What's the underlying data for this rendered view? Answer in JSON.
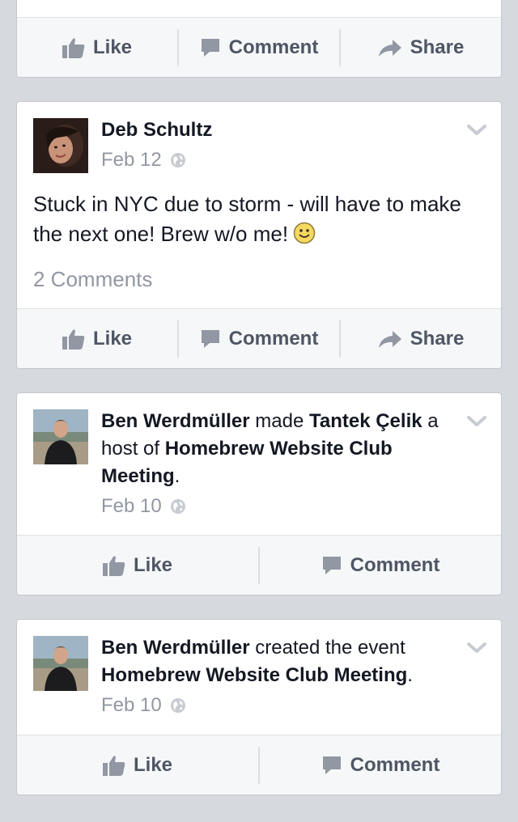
{
  "actions": {
    "like": "Like",
    "comment": "Comment",
    "share": "Share"
  },
  "colors": {
    "background": "#d6d9de",
    "card": "#ffffff",
    "action_bar": "#f6f7f8",
    "text": "#141823",
    "muted": "#9197a3",
    "action_text": "#4e5665"
  },
  "icons": [
    "thumbs-up-icon",
    "comment-bubble-icon",
    "share-arrow-icon",
    "globe-icon",
    "chevron-down-icon",
    "smiley-icon"
  ],
  "posts": [
    {
      "author": "Deb Schultz",
      "date": "Feb 12",
      "text": "Stuck in NYC due to storm - will have to make the next one! Brew w/o me!",
      "comments": "2 Comments"
    },
    {
      "author": "Ben Werdmüller",
      "verb": " made ",
      "target": "Tantek Çelik",
      "middle": " a host of ",
      "event": "Homebrew Website Club Meeting",
      "end": ".",
      "date": "Feb 10"
    },
    {
      "author": "Ben Werdmüller",
      "verb": " created the event ",
      "event": "Homebrew Website Club Meeting",
      "end": ".",
      "date": "Feb 10"
    }
  ]
}
